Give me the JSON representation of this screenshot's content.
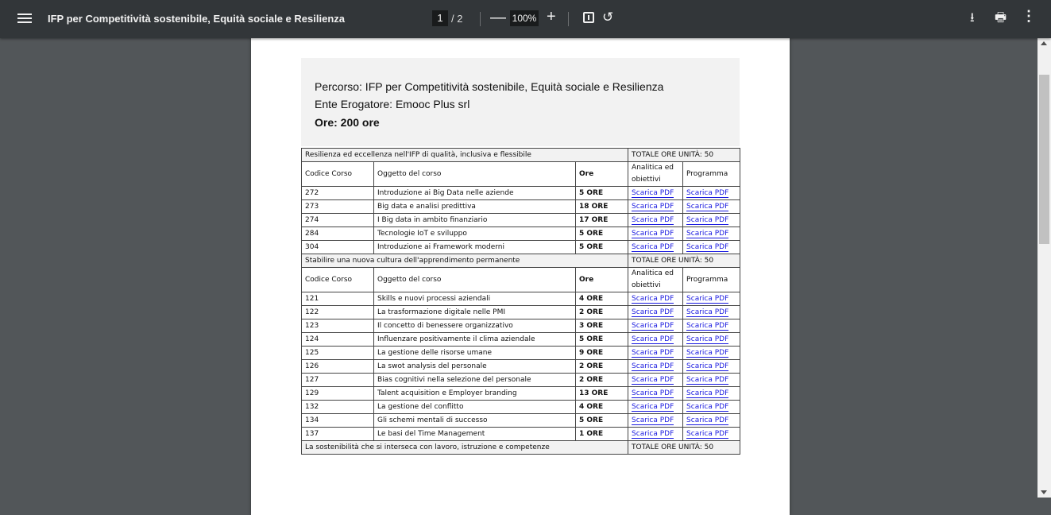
{
  "toolbar": {
    "title": "IFP per Competitività sostenibile, Equità sociale e Resilienza",
    "current_page": "1",
    "page_separator": "/ 2",
    "zoom": "100%",
    "zoom_out": "—",
    "zoom_in": "+",
    "rotate_icon": "↺",
    "download_icon": "⭳",
    "print_icon": "🖶",
    "more_icon": "⋮"
  },
  "header": {
    "percorso": "Percorso: IFP per Competitività sostenibile, Equità sociale e Resilienza",
    "ente": "Ente Erogatore: Emooc Plus srl",
    "ore": "Ore: 200 ore"
  },
  "col_headers": {
    "codice": "Codice Corso",
    "oggetto": "Oggetto del corso",
    "ore": "Ore",
    "analitica": "Analitica ed obiettivi",
    "programma": "Programma"
  },
  "link_label": "Scarica PDF",
  "sections": [
    {
      "title": "Resilienza ed eccellenza nell'IFP di qualità, inclusiva e flessibile",
      "total": "TOTALE ORE UNITÀ: 50",
      "rows": [
        {
          "code": "272",
          "subject": "Introduzione ai Big Data nelle aziende",
          "hours": "5 ORE"
        },
        {
          "code": "273",
          "subject": "Big data e analisi predittiva",
          "hours": "18 ORE"
        },
        {
          "code": "274",
          "subject": "I Big data in ambito finanziario",
          "hours": "17 ORE"
        },
        {
          "code": "284",
          "subject": "Tecnologie IoT e sviluppo",
          "hours": "5 ORE"
        },
        {
          "code": "304",
          "subject": "Introduzione ai Framework moderni",
          "hours": "5 ORE"
        }
      ]
    },
    {
      "title": "Stabilire una nuova cultura dell'apprendimento permanente",
      "total": "TOTALE ORE UNITÀ: 50",
      "rows": [
        {
          "code": "121",
          "subject": "Skills e nuovi processi aziendali",
          "hours": "4 ORE"
        },
        {
          "code": "122",
          "subject": "La trasformazione digitale nelle PMI",
          "hours": "2 ORE"
        },
        {
          "code": "123",
          "subject": "Il concetto di benessere organizzativo",
          "hours": "3 ORE"
        },
        {
          "code": "124",
          "subject": "Influenzare positivamente il clima aziendale",
          "hours": "5 ORE"
        },
        {
          "code": "125",
          "subject": "La gestione delle risorse umane",
          "hours": "9 ORE"
        },
        {
          "code": "126",
          "subject": "La swot analysis del personale",
          "hours": "2 ORE"
        },
        {
          "code": "127",
          "subject": "Bias cognitivi nella selezione del personale",
          "hours": "2 ORE"
        },
        {
          "code": "129",
          "subject": "Talent acquisition e Employer branding",
          "hours": "13 ORE"
        },
        {
          "code": "132",
          "subject": "La gestione del conflitto",
          "hours": "4 ORE"
        },
        {
          "code": "134",
          "subject": "Gli schemi mentali di successo",
          "hours": "5 ORE"
        },
        {
          "code": "137",
          "subject": "Le basi del Time Management",
          "hours": "1 ORE"
        }
      ]
    },
    {
      "title": "La sostenibilità che si interseca con lavoro, istruzione e competenze",
      "total": "TOTALE ORE UNITÀ: 50",
      "rows": []
    }
  ]
}
